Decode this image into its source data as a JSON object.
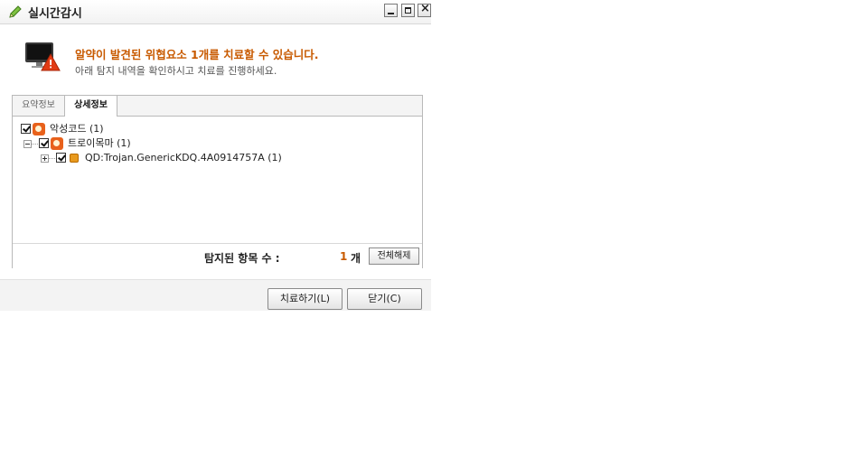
{
  "window": {
    "title": "실시간감시",
    "buttons": {
      "minimize": "minimize",
      "maximize": "maximize",
      "close": "close"
    }
  },
  "header": {
    "headline": "알약이 발견된 위협요소 1개를 치료할 수 있습니다.",
    "subline": "아래 탐지 내역을 확인하시고 치료를 진행하세요."
  },
  "tabs": [
    {
      "label": "요약정보",
      "selected": false
    },
    {
      "label": "상세정보",
      "selected": true
    }
  ],
  "tree": {
    "root": {
      "label": "악성코드 (1)",
      "checked": true
    },
    "category": {
      "label": "트로이목마 (1)",
      "checked": true,
      "expanded": true
    },
    "item": {
      "label": "QD:Trojan.GenericKDQ.4A0914757A (1)",
      "checked": true,
      "expanded": false
    }
  },
  "summary": {
    "count_label": "탐지된 항목 수 :",
    "count_value": "1",
    "count_unit": "개",
    "deselect_all_label": "전체해제"
  },
  "actions": {
    "treat_label": "치료하기(L)",
    "close_label": "닫기(C)"
  },
  "colors": {
    "accent_orange": "#c85a00",
    "threat_icon": "#e8611b"
  }
}
